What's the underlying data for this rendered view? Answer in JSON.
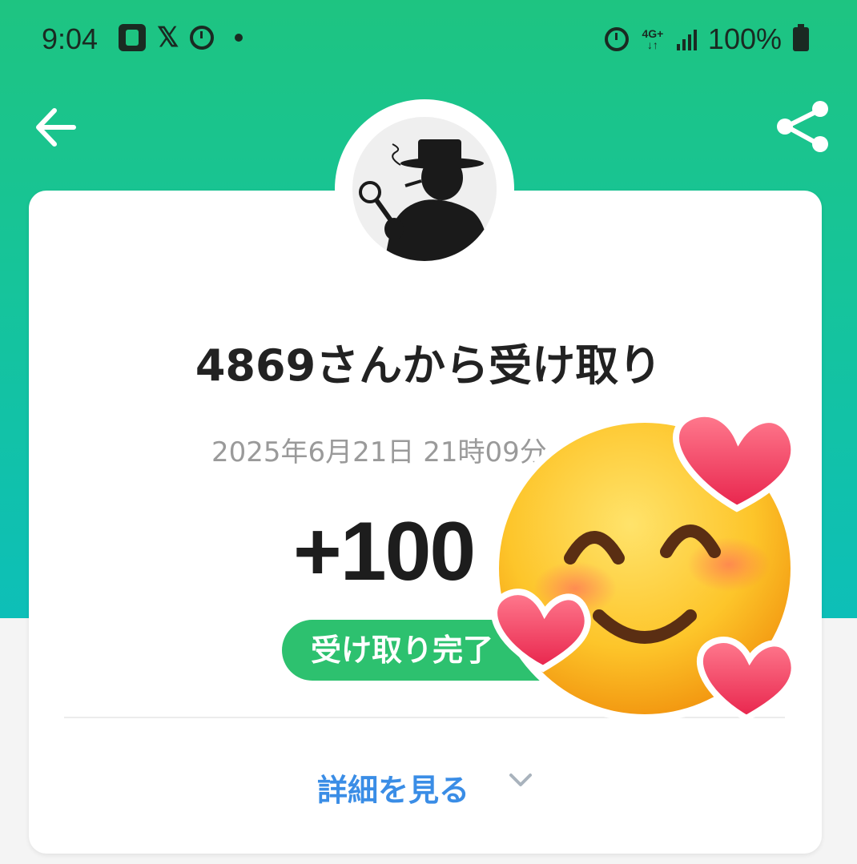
{
  "status_bar": {
    "time": "9:04",
    "network": "4G+",
    "battery_text": "100%"
  },
  "nav": {
    "back_icon": "arrow-left-icon",
    "share_icon": "share-icon"
  },
  "card": {
    "title": "4869さんから受け取り",
    "date": "2025年6月21日 21時09分",
    "amount": "+100",
    "status": "受け取り完了",
    "details_label": "詳細を見る"
  },
  "colors": {
    "header_top": "#1ec481",
    "header_bottom": "#0dbfb8",
    "status_pill": "#2dc16f",
    "link": "#3a8de6"
  },
  "sticker": {
    "icon": "smiling-face-with-hearts-emoji"
  }
}
